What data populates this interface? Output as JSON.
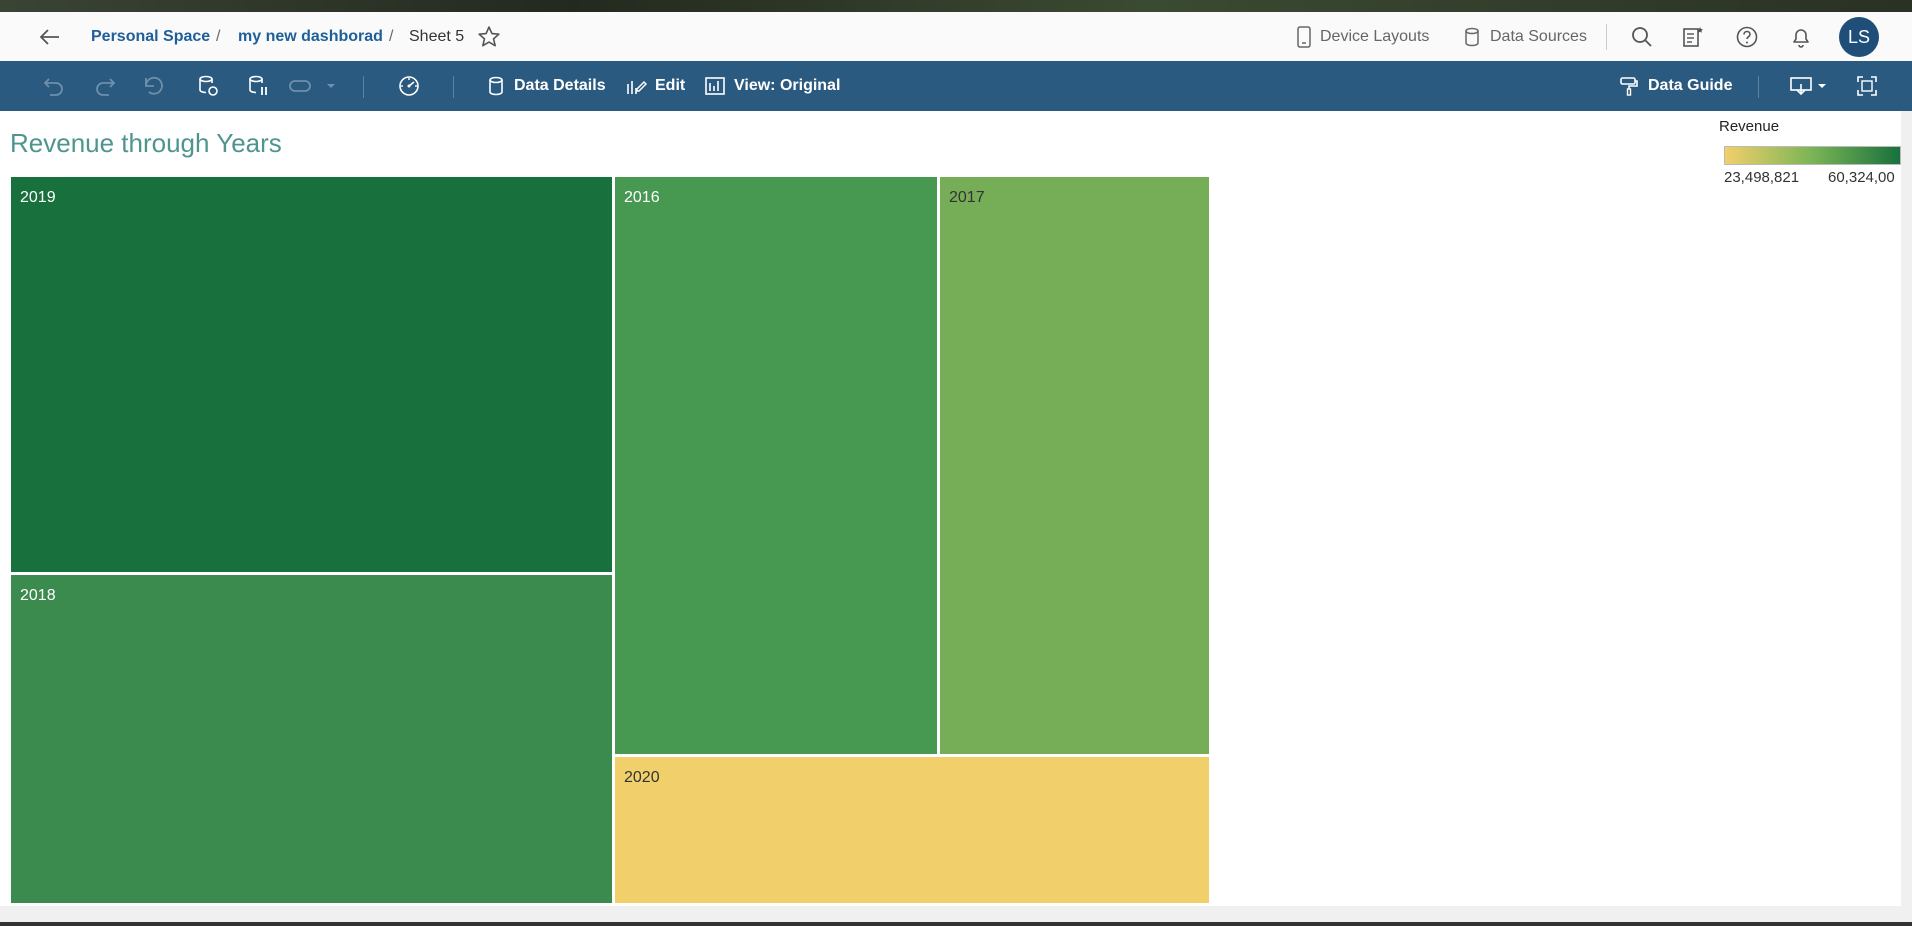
{
  "header": {
    "breadcrumb": {
      "personal_space": "Personal Space",
      "sep1": "/",
      "dashboard": "my new dashborad",
      "sep2": "/",
      "sheet": "Sheet 5"
    },
    "device_layouts": "Device Layouts",
    "data_sources": "Data Sources",
    "avatar_initials": "LS"
  },
  "toolbar": {
    "data_details": "Data Details",
    "edit": "Edit",
    "view": "View: Original",
    "data_guide": "Data Guide"
  },
  "sheet": {
    "title": "Revenue through Years"
  },
  "chart_data": {
    "type": "treemap",
    "categories": [
      "2019",
      "2018",
      "2016",
      "2017",
      "2020"
    ],
    "values": [
      60324000,
      52000000,
      47000000,
      38000000,
      23498821
    ],
    "colors": {
      "2019": "#18713d",
      "2018": "#3b8b4e",
      "2016": "#479952",
      "2017": "#75ae57",
      "2020": "#f1d06b"
    },
    "legend": {
      "title": "Revenue",
      "min": "23,498,821",
      "max": "60,324,00",
      "gradient": [
        "#f1d06b",
        "#7ab456",
        "#18713d"
      ],
      "position": "top-right"
    }
  }
}
